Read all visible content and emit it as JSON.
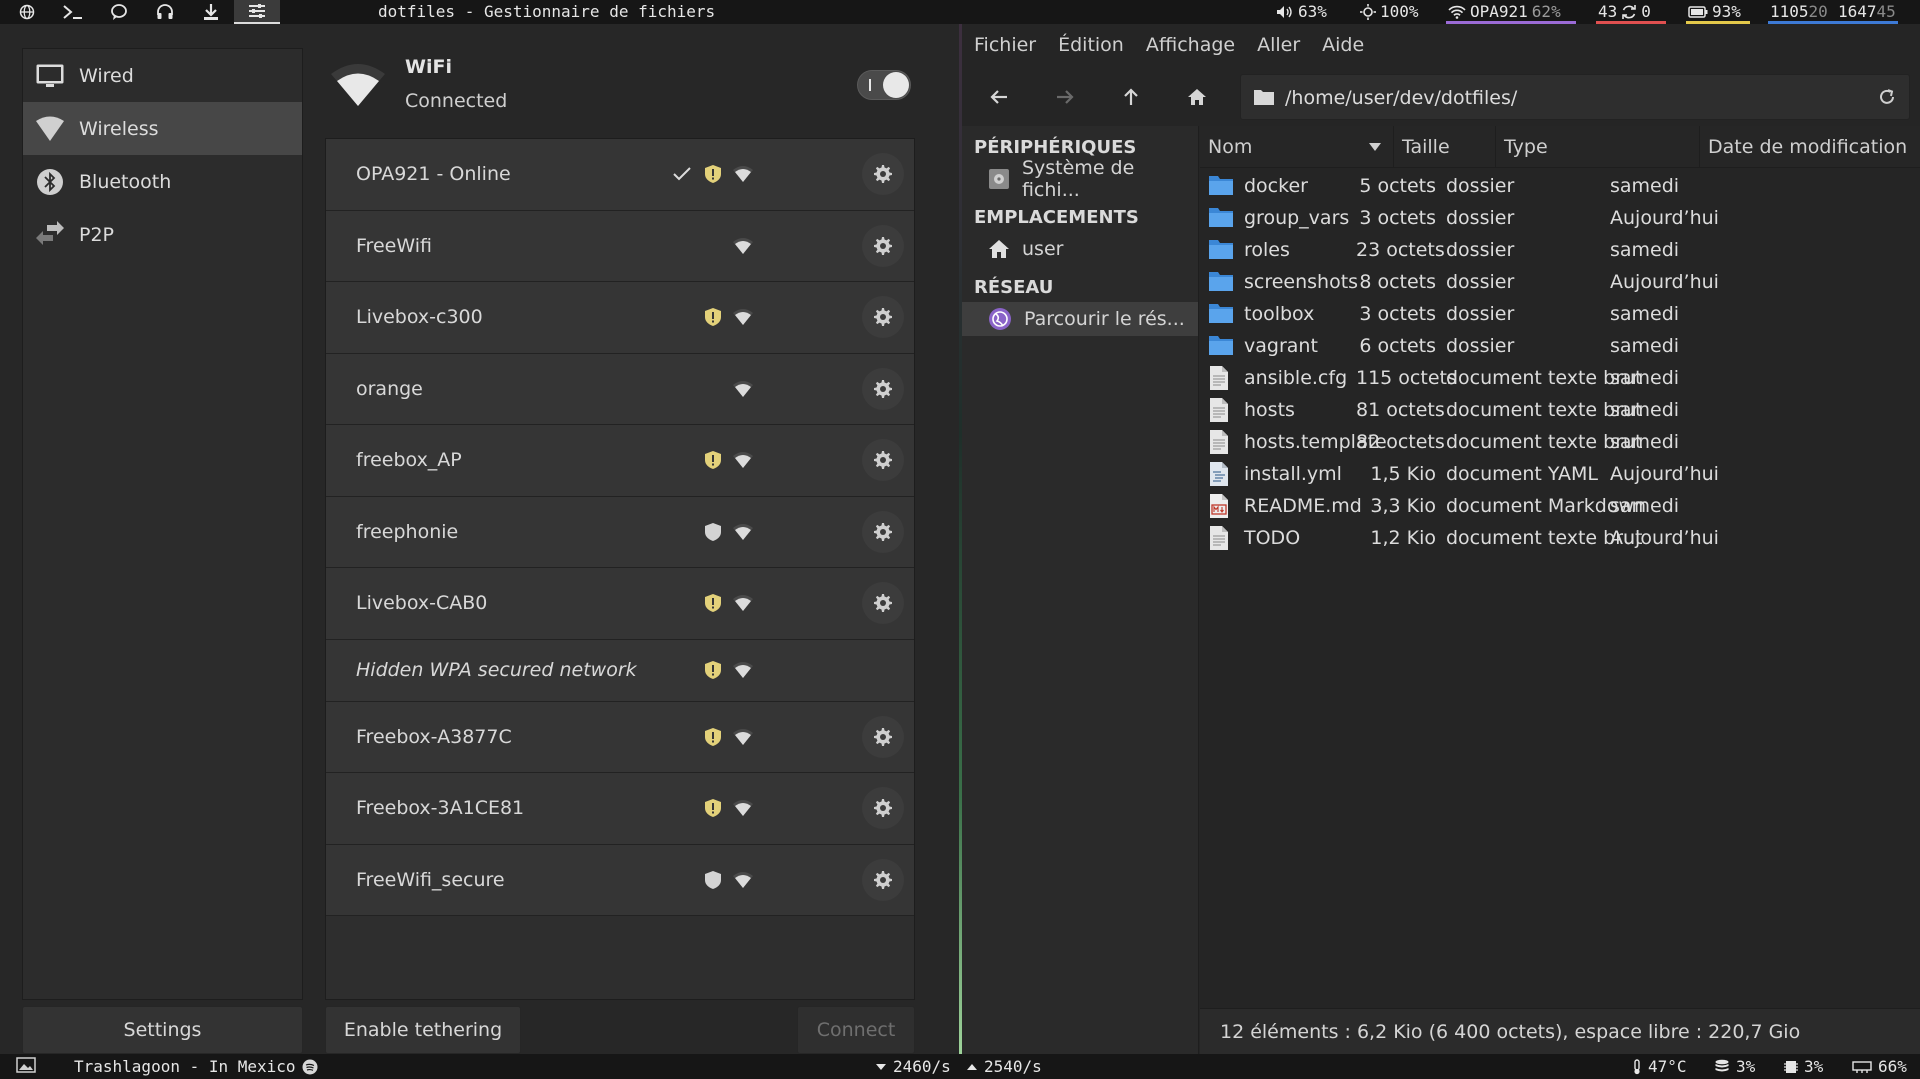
{
  "topbar": {
    "window_title": "dotfiles - Gestionnaire de fichiers",
    "volume": "63%",
    "brightness": "100%",
    "wifi": "OPA921",
    "wifi_signal": "62%",
    "updates": "43",
    "sync": "0",
    "battery": "93%",
    "clock_a": "1105",
    "clock_a2": "20",
    "clock_b": "1647",
    "clock_b2": "45",
    "colors": {
      "wifi": "#9b6bd6",
      "updates": "#e05050",
      "battery": "#e3c84a",
      "clock": "#3d7ad6"
    }
  },
  "nm": {
    "sidebar": [
      {
        "label": "Wired",
        "icon": "monitor-icon"
      },
      {
        "label": "Wireless",
        "icon": "wifi-icon"
      },
      {
        "label": "Bluetooth",
        "icon": "bluetooth-icon"
      },
      {
        "label": "P2P",
        "icon": "p2p-icon"
      }
    ],
    "wifi_title": "WiFi",
    "wifi_status": "Connected",
    "networks": [
      {
        "name": "OPA921 - Online",
        "connected": true,
        "shield": "yellow",
        "gear": true
      },
      {
        "name": "FreeWifi",
        "shield": "none",
        "gear": true
      },
      {
        "name": "Livebox-c300",
        "shield": "yellow",
        "gear": true
      },
      {
        "name": "orange",
        "shield": "none",
        "gear": true
      },
      {
        "name": "freebox_AP",
        "shield": "yellow",
        "gear": true
      },
      {
        "name": "freephonie",
        "shield": "grey",
        "gear": true
      },
      {
        "name": "Livebox-CAB0",
        "shield": "yellow",
        "gear": true
      },
      {
        "name": "Hidden WPA secured network",
        "shield": "yellow",
        "gear": false,
        "italic": true
      },
      {
        "name": "Freebox-A3877C",
        "shield": "yellow",
        "gear": true
      },
      {
        "name": "Freebox-3A1CE81",
        "shield": "yellow",
        "gear": true
      },
      {
        "name": "FreeWifi_secure",
        "shield": "grey",
        "gear": true
      }
    ],
    "settings_label": "Settings",
    "tether_label": "Enable tethering",
    "connect_label": "Connect"
  },
  "fm": {
    "menu": [
      "Fichier",
      "Édition",
      "Affichage",
      "Aller",
      "Aide"
    ],
    "path": "/home/user/dev/dotfiles/",
    "places": {
      "devices_header": "PÉRIPHÉRIQUES",
      "filesystem": "Système de fichi...",
      "places_header": "EMPLACEMENTS",
      "user": "user",
      "network_header": "RÉSEAU",
      "browse": "Parcourir le rés..."
    },
    "columns": {
      "name": "Nom",
      "size": "Taille",
      "type": "Type",
      "date": "Date de modification"
    },
    "files": [
      {
        "name": "docker",
        "size": "5 octets",
        "type": "dossier",
        "date": "samedi",
        "kind": "folder"
      },
      {
        "name": "group_vars",
        "size": "3 octets",
        "type": "dossier",
        "date": "Aujourd’hui",
        "kind": "folder"
      },
      {
        "name": "roles",
        "size": "23 octets",
        "type": "dossier",
        "date": "samedi",
        "kind": "folder"
      },
      {
        "name": "screenshots",
        "size": "8 octets",
        "type": "dossier",
        "date": "Aujourd’hui",
        "kind": "folder"
      },
      {
        "name": "toolbox",
        "size": "3 octets",
        "type": "dossier",
        "date": "samedi",
        "kind": "folder"
      },
      {
        "name": "vagrant",
        "size": "6 octets",
        "type": "dossier",
        "date": "samedi",
        "kind": "folder"
      },
      {
        "name": "ansible.cfg",
        "size": "115 octets",
        "type": "document texte brut",
        "date": "samedi",
        "kind": "text"
      },
      {
        "name": "hosts",
        "size": "81 octets",
        "type": "document texte brut",
        "date": "samedi",
        "kind": "text"
      },
      {
        "name": "hosts.template",
        "size": "82 octets",
        "type": "document texte brut",
        "date": "samedi",
        "kind": "text"
      },
      {
        "name": "install.yml",
        "size": "1,5 Kio",
        "type": "document YAML",
        "date": "Aujourd’hui",
        "kind": "yaml"
      },
      {
        "name": "README.md",
        "size": "3,3 Kio",
        "type": "document Markdown",
        "date": "samedi",
        "kind": "markdown"
      },
      {
        "name": "TODO",
        "size": "1,2 Kio",
        "type": "document texte brut",
        "date": "Aujourd’hui",
        "kind": "text"
      }
    ],
    "status": "12 éléments : 6,2 Kio (6 400 octets), espace libre : 220,7 Gio"
  },
  "bottombar": {
    "media": "Trashlagoon - In Mexico",
    "down": "2460/s",
    "up": "2540/s",
    "temp": "47°C",
    "disk": "3%",
    "cpu": "3%",
    "mem": "66%"
  }
}
